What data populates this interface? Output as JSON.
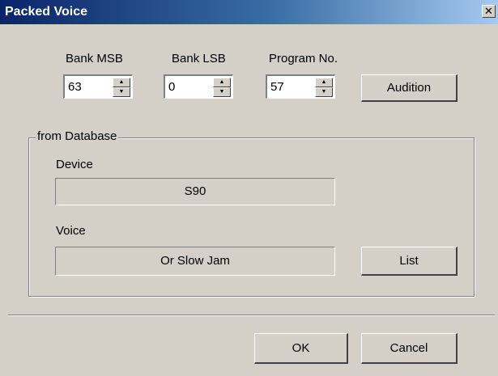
{
  "window": {
    "title": "Packed Voice",
    "close_glyph": "✕"
  },
  "fields": {
    "bank_msb": {
      "label": "Bank MSB",
      "value": "63"
    },
    "bank_lsb": {
      "label": "Bank LSB",
      "value": "0"
    },
    "program_no": {
      "label": "Program No.",
      "value": "57"
    }
  },
  "spin_glyphs": {
    "up": "▲",
    "down": "▼"
  },
  "audition_label": "Audition",
  "database": {
    "group_label": "from Database",
    "device_label": "Device",
    "device_value": "S90",
    "voice_label": "Voice",
    "voice_value": "Or Slow Jam",
    "list_label": "List"
  },
  "footer": {
    "ok_label": "OK",
    "cancel_label": "Cancel"
  }
}
